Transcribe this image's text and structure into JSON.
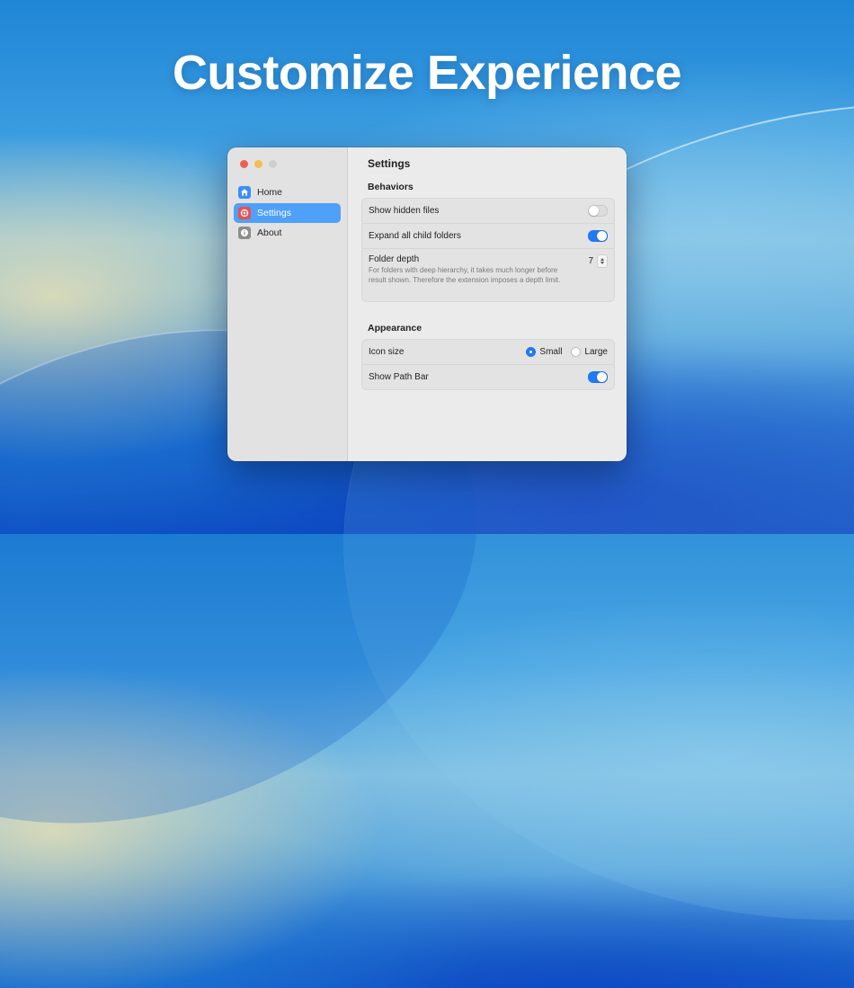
{
  "headline": "Customize Experience",
  "window": {
    "sidebar": {
      "items": [
        {
          "label": "Home",
          "icon": "home-icon",
          "active": false
        },
        {
          "label": "Settings",
          "icon": "settings-icon",
          "active": true
        },
        {
          "label": "About",
          "icon": "info-icon",
          "active": false
        }
      ]
    },
    "main": {
      "title": "Settings",
      "behaviors": {
        "heading": "Behaviors",
        "show_hidden_files": {
          "label": "Show hidden files",
          "on": false
        },
        "expand_child_folders": {
          "label": "Expand all child folders",
          "on": true
        },
        "folder_depth": {
          "label": "Folder depth",
          "value": "7",
          "description": "For folders with deep hierarchy, it takes much longer before result shown. Therefore the extension imposes a depth limit."
        }
      },
      "appearance": {
        "heading": "Appearance",
        "icon_size": {
          "label": "Icon size",
          "options": [
            "Small",
            "Large"
          ],
          "selected": "Small"
        },
        "show_path_bar": {
          "label": "Show Path Bar",
          "on": true
        }
      }
    }
  },
  "colors": {
    "accent": "#1f7af4",
    "sidebar_selection": "#4fa0f8"
  }
}
